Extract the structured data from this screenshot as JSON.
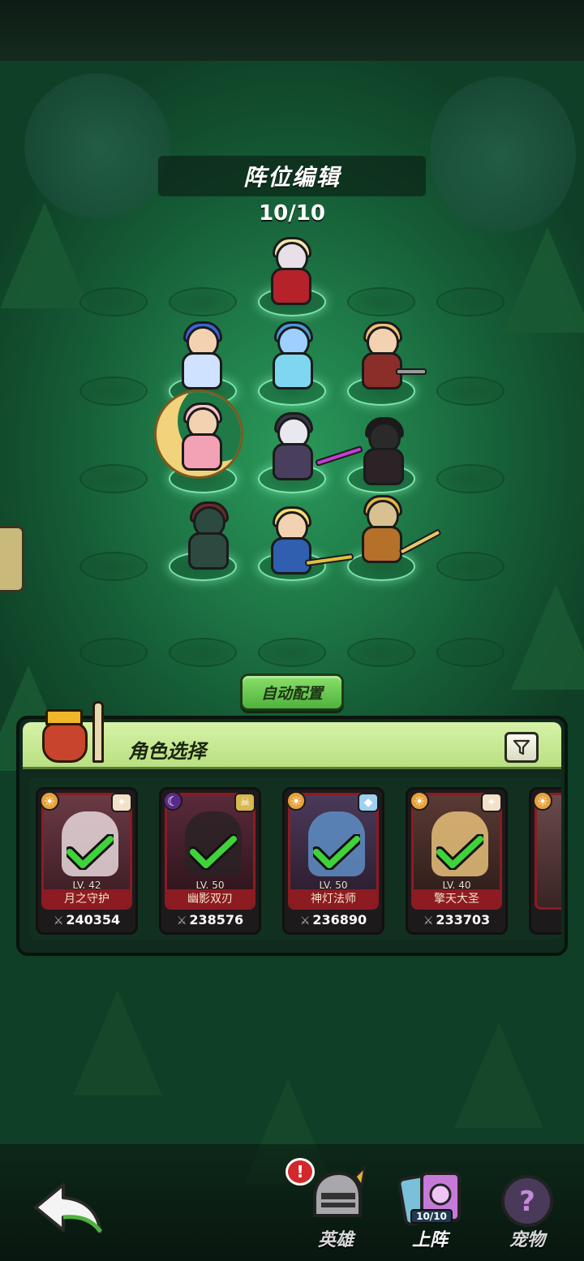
{
  "title": "阵位编辑",
  "lineup_count": "10/10",
  "auto_config_label": "自动配置",
  "panel": {
    "title": "角色选择",
    "filter_icon": "filter-icon"
  },
  "cards": [
    {
      "level": "LV. 42",
      "name": "月之守护",
      "power": "240354",
      "element": "sun",
      "selected": true
    },
    {
      "level": "LV. 50",
      "name": "幽影双刃",
      "power": "238576",
      "element": "moon",
      "selected": true
    },
    {
      "level": "LV. 50",
      "name": "神灯法师",
      "power": "236890",
      "element": "sun",
      "selected": true
    },
    {
      "level": "LV. 40",
      "name": "擎天大圣",
      "power": "233703",
      "element": "sun",
      "selected": true
    }
  ],
  "nav": {
    "heroes_label": "英雄",
    "lineup_label": "上阵",
    "lineup_badge": "10/10",
    "pets_label": "宠物",
    "alert": "!"
  },
  "colors": {
    "accent_green": "#4fb23e",
    "card_frame_red": "#8c1b22",
    "check_green": "#3fd23a"
  }
}
